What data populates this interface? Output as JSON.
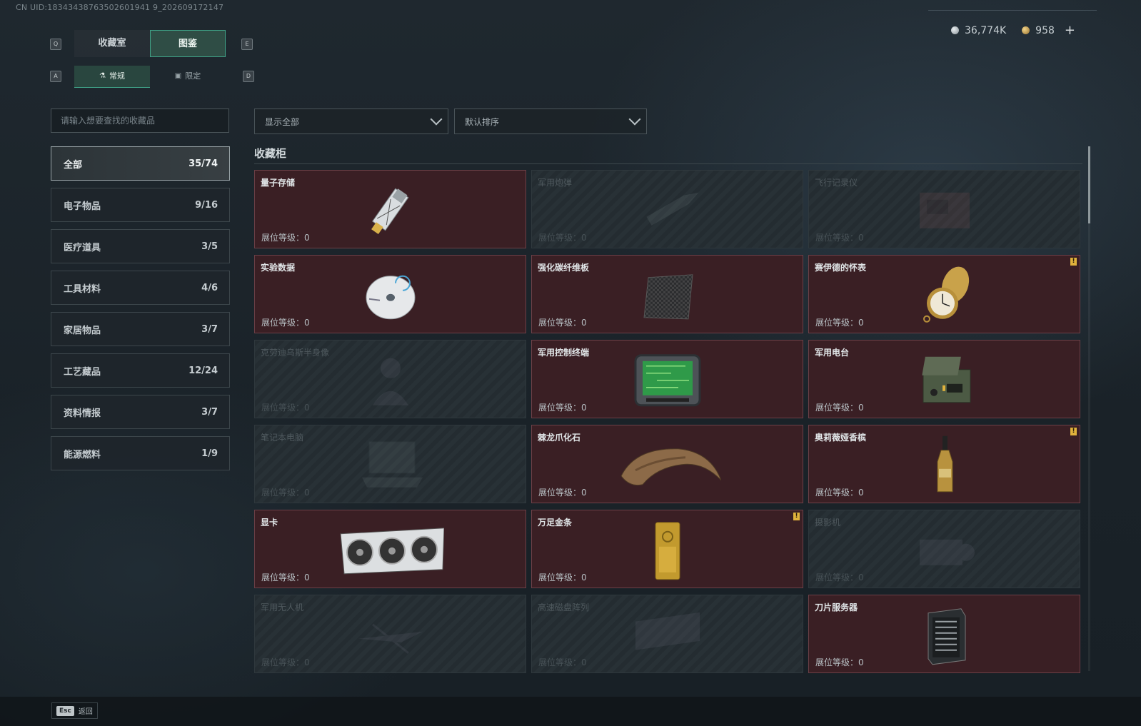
{
  "uid_text": "CN UID:18343438763502601941 9_202609172147",
  "currency": {
    "silver": "36,774K",
    "gold": "958",
    "add": "+"
  },
  "keys": {
    "q": "Q",
    "e": "E",
    "a": "A",
    "d": "D"
  },
  "main_tabs": [
    {
      "label": "收藏室"
    },
    {
      "label": "图鉴"
    }
  ],
  "sub_tabs": [
    {
      "label": "常规"
    },
    {
      "label": "限定"
    }
  ],
  "search": {
    "placeholder": "请输入想要查找的收藏品"
  },
  "categories": [
    {
      "label": "全部",
      "count": "35/74"
    },
    {
      "label": "电子物品",
      "count": "9/16"
    },
    {
      "label": "医疗道具",
      "count": "3/5"
    },
    {
      "label": "工具材料",
      "count": "4/6"
    },
    {
      "label": "家居物品",
      "count": "3/7"
    },
    {
      "label": "工艺藏品",
      "count": "12/24"
    },
    {
      "label": "资料情报",
      "count": "3/7"
    },
    {
      "label": "能源燃料",
      "count": "1/9"
    }
  ],
  "filters": {
    "show": "显示全部",
    "sort": "默认排序"
  },
  "section_title": "收藏柜",
  "level_text": "展位等级：0",
  "items": [
    {
      "name": "量子存储",
      "owned": true,
      "icon": "usb-drive-icon",
      "badge": ""
    },
    {
      "name": "军用炮弹",
      "owned": false,
      "icon": "shell-icon",
      "badge": ""
    },
    {
      "name": "飞行记录仪",
      "owned": false,
      "icon": "flight-recorder-icon",
      "badge": ""
    },
    {
      "name": "实验数据",
      "owned": true,
      "icon": "disc-icon",
      "badge": ""
    },
    {
      "name": "强化碳纤维板",
      "owned": true,
      "icon": "carbon-plate-icon",
      "badge": ""
    },
    {
      "name": "赛伊德的怀表",
      "owned": true,
      "icon": "pocket-watch-icon",
      "badge": "!"
    },
    {
      "name": "克劳迪乌斯半身像",
      "owned": false,
      "icon": "bust-icon",
      "badge": ""
    },
    {
      "name": "军用控制终端",
      "owned": true,
      "icon": "control-terminal-icon",
      "badge": ""
    },
    {
      "name": "军用电台",
      "owned": true,
      "icon": "radio-icon",
      "badge": ""
    },
    {
      "name": "笔记本电脑",
      "owned": false,
      "icon": "laptop-icon",
      "badge": ""
    },
    {
      "name": "棘龙爪化石",
      "owned": true,
      "icon": "claw-fossil-icon",
      "badge": ""
    },
    {
      "name": "奥莉薇娅香槟",
      "owned": true,
      "icon": "champagne-icon",
      "badge": "!"
    },
    {
      "name": "显卡",
      "owned": true,
      "icon": "graphics-card-icon",
      "badge": ""
    },
    {
      "name": "万足金条",
      "owned": true,
      "icon": "gold-bar-icon",
      "badge": "!"
    },
    {
      "name": "摄影机",
      "owned": false,
      "icon": "camera-icon",
      "badge": ""
    },
    {
      "name": "军用无人机",
      "owned": false,
      "icon": "drone-icon",
      "badge": ""
    },
    {
      "name": "高速磁盘阵列",
      "owned": false,
      "icon": "disk-array-icon",
      "badge": ""
    },
    {
      "name": "刀片服务器",
      "owned": true,
      "icon": "blade-server-icon",
      "badge": ""
    }
  ],
  "footer": {
    "key": "Esc",
    "label": "返回"
  }
}
